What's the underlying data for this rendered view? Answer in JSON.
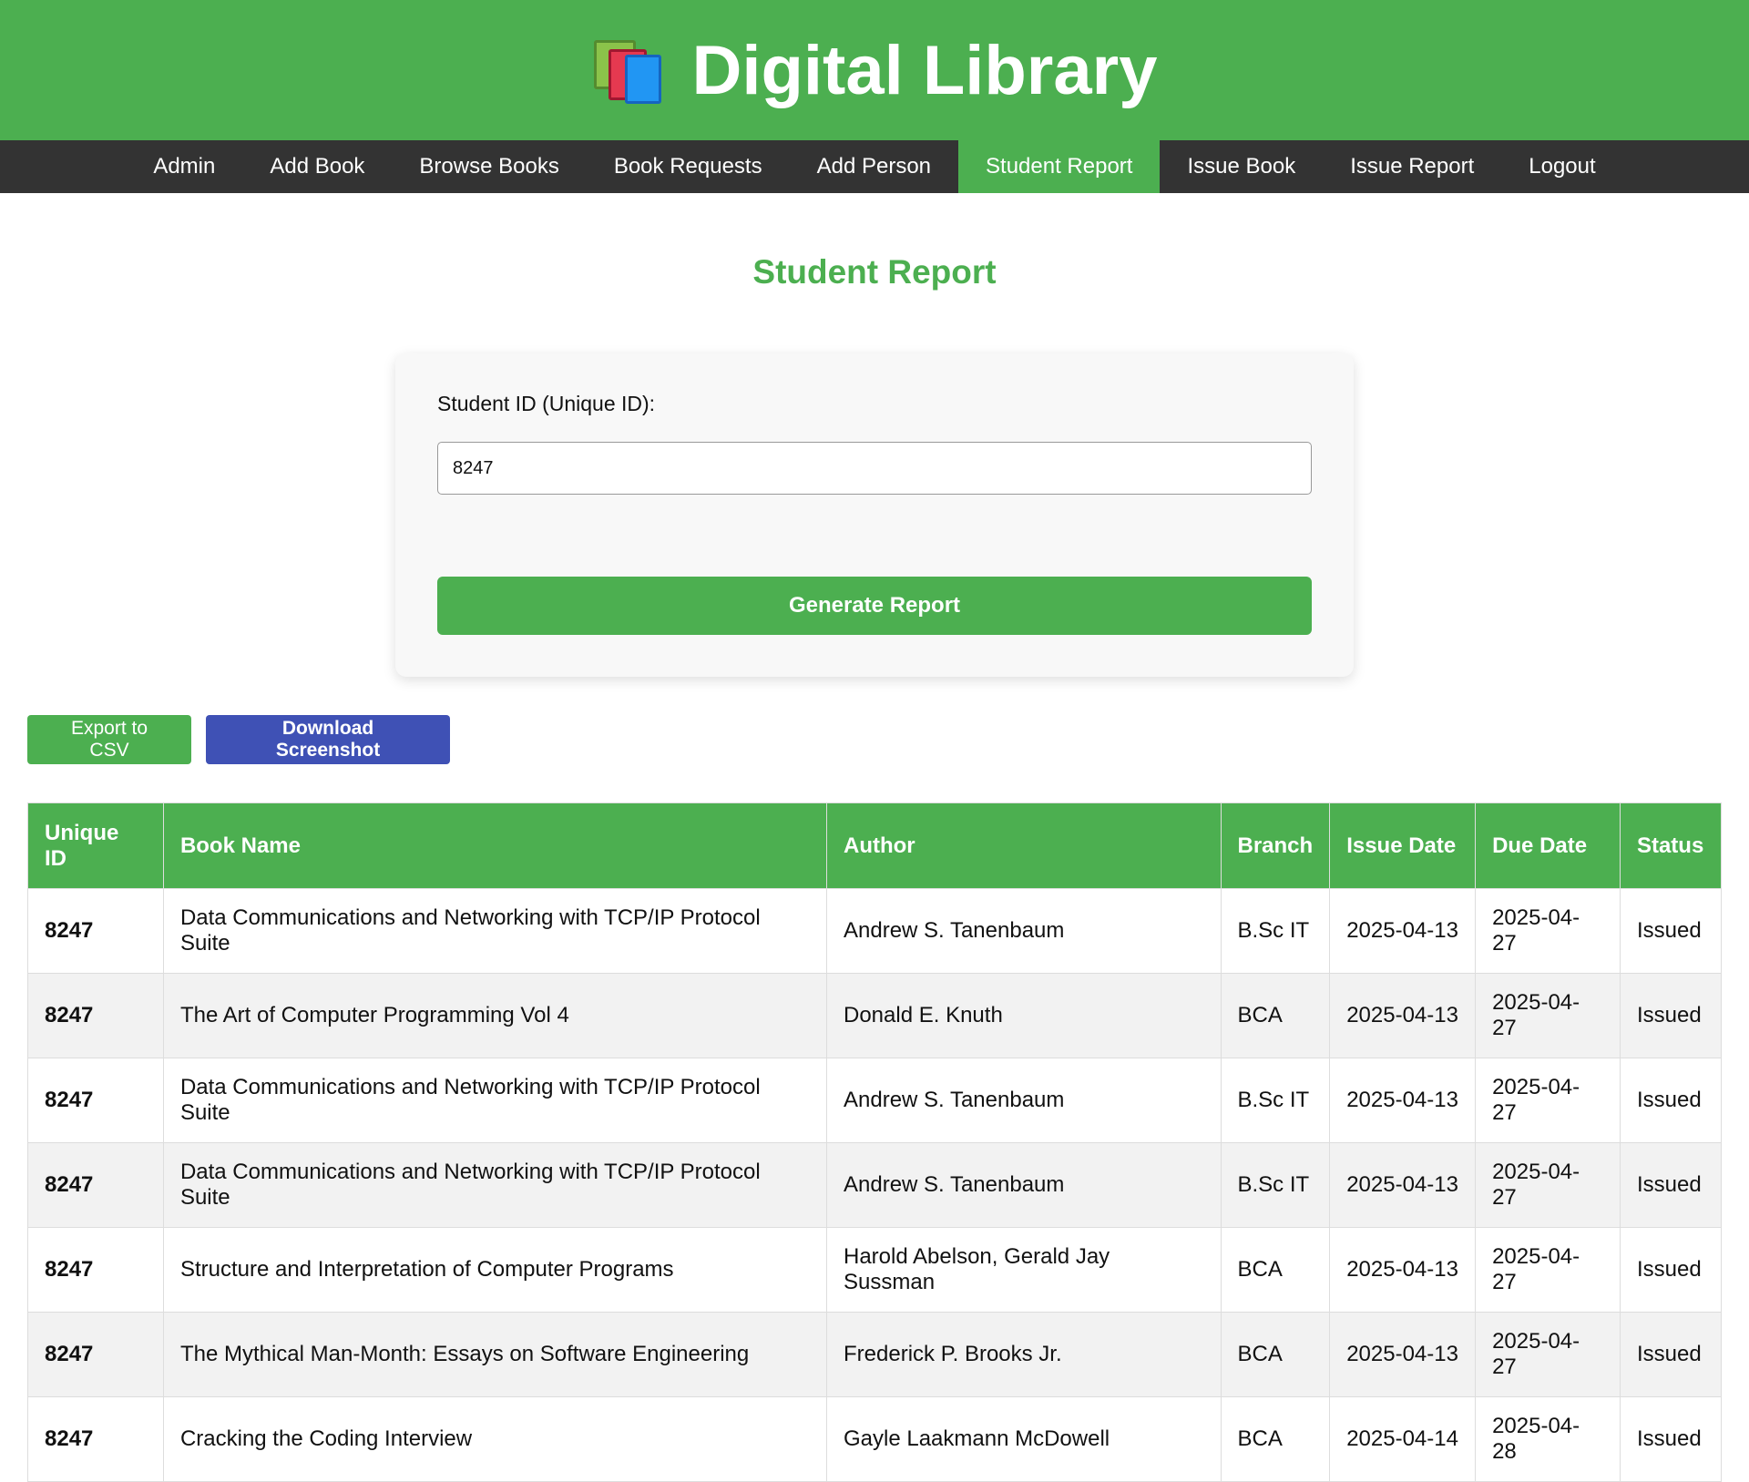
{
  "app": {
    "title": "Digital Library",
    "logo_icon": "books-icon"
  },
  "nav": {
    "items": [
      {
        "label": "Admin"
      },
      {
        "label": "Add Book"
      },
      {
        "label": "Browse Books"
      },
      {
        "label": "Book Requests"
      },
      {
        "label": "Add Person"
      },
      {
        "label": "Student Report",
        "active": true
      },
      {
        "label": "Issue Book"
      },
      {
        "label": "Issue Report"
      },
      {
        "label": "Logout"
      }
    ]
  },
  "page": {
    "title": "Student Report"
  },
  "form": {
    "student_id_label": "Student ID (Unique ID):",
    "student_id_value": "8247",
    "generate_label": "Generate Report"
  },
  "actions": {
    "export_label": "Export to CSV",
    "screenshot_label": "Download Screenshot"
  },
  "table": {
    "headers": [
      "Unique ID",
      "Book Name",
      "Author",
      "Branch",
      "Issue Date",
      "Due Date",
      "Status"
    ],
    "rows": [
      [
        "8247",
        "Data Communications and Networking with TCP/IP Protocol Suite",
        "Andrew S. Tanenbaum",
        "B.Sc IT",
        "2025-04-13",
        "2025-04-27",
        "Issued"
      ],
      [
        "8247",
        "The Art of Computer Programming Vol 4",
        "Donald E. Knuth",
        "BCA",
        "2025-04-13",
        "2025-04-27",
        "Issued"
      ],
      [
        "8247",
        "Data Communications and Networking with TCP/IP Protocol Suite",
        "Andrew S. Tanenbaum",
        "B.Sc IT",
        "2025-04-13",
        "2025-04-27",
        "Issued"
      ],
      [
        "8247",
        "Data Communications and Networking with TCP/IP Protocol Suite",
        "Andrew S. Tanenbaum",
        "B.Sc IT",
        "2025-04-13",
        "2025-04-27",
        "Issued"
      ],
      [
        "8247",
        "Structure and Interpretation of Computer Programs",
        "Harold Abelson, Gerald Jay Sussman",
        "BCA",
        "2025-04-13",
        "2025-04-27",
        "Issued"
      ],
      [
        "8247",
        "The Mythical Man-Month: Essays on Software Engineering",
        "Frederick P. Brooks Jr.",
        "BCA",
        "2025-04-13",
        "2025-04-27",
        "Issued"
      ],
      [
        "8247",
        "Cracking the Coding Interview",
        "Gayle Laakmann McDowell",
        "BCA",
        "2025-04-14",
        "2025-04-28",
        "Issued"
      ]
    ]
  },
  "colors": {
    "primary_green": "#4caf50",
    "nav_dark": "#333333",
    "indigo_button": "#3f51b5"
  }
}
